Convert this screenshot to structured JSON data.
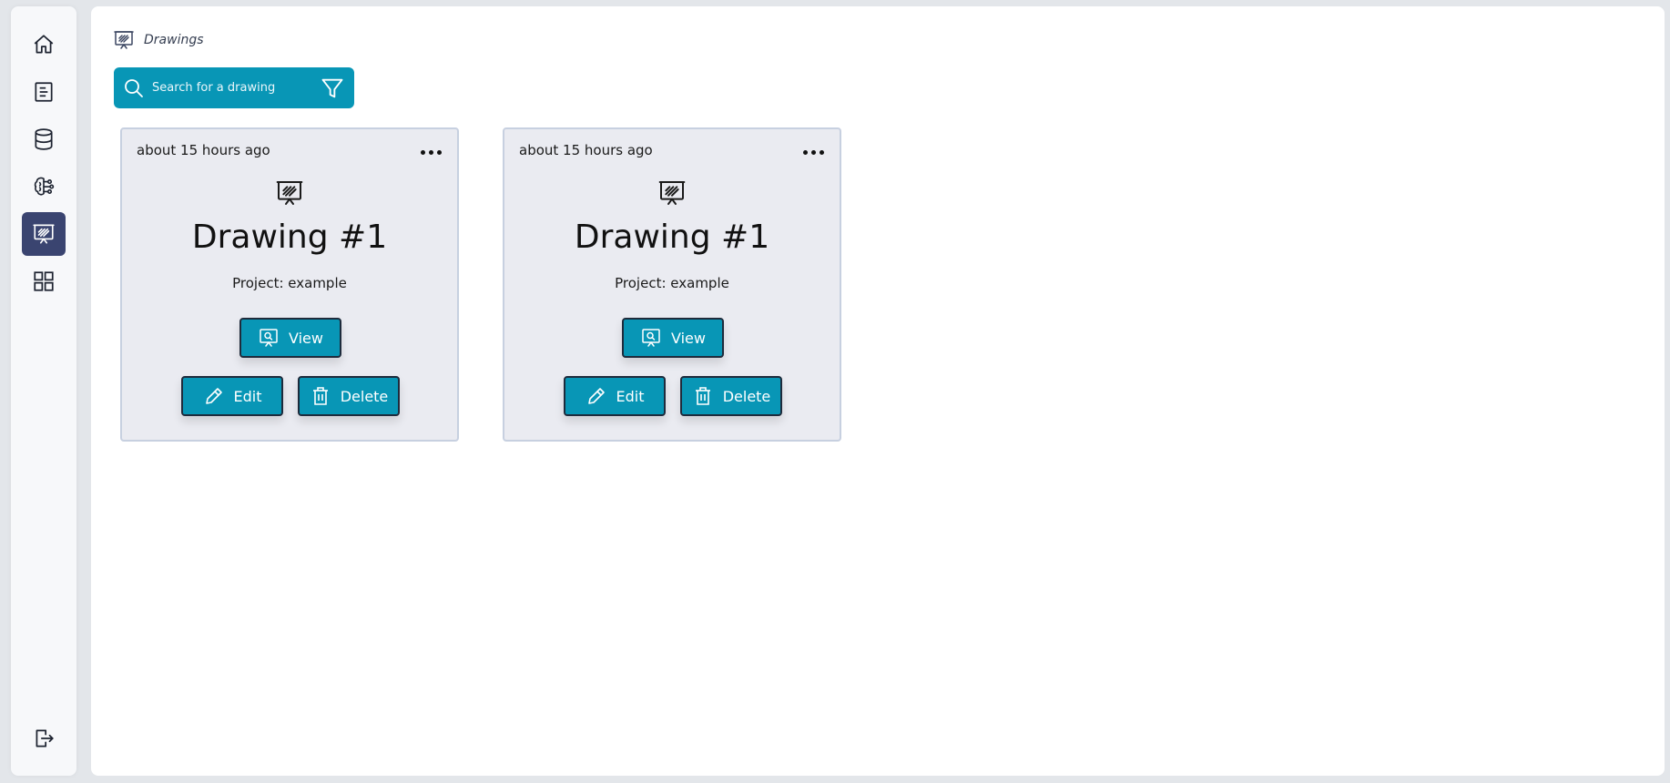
{
  "sidebar": {
    "items": [
      {
        "name": "home-icon",
        "active": false
      },
      {
        "name": "document-icon",
        "active": false
      },
      {
        "name": "database-icon",
        "active": false
      },
      {
        "name": "brain-circuit-icon",
        "active": false
      },
      {
        "name": "drawing-board-icon",
        "active": true
      },
      {
        "name": "grid-icon",
        "active": false
      }
    ],
    "logout_icon": "logout-icon"
  },
  "breadcrumb": {
    "icon": "drawing-board-icon",
    "label": "Drawings"
  },
  "search": {
    "placeholder": "Search for a drawing",
    "value": ""
  },
  "cards": [
    {
      "time": "about 15 hours ago",
      "title": "Drawing #1",
      "project": "Project: example",
      "view_label": "View",
      "edit_label": "Edit",
      "delete_label": "Delete"
    },
    {
      "time": "about 15 hours ago",
      "title": "Drawing #1",
      "project": "Project: example",
      "view_label": "View",
      "edit_label": "Edit",
      "delete_label": "Delete"
    }
  ],
  "colors": {
    "accent": "#0896b6",
    "active_nav": "#3a4470",
    "card_bg": "#eaebf1"
  }
}
